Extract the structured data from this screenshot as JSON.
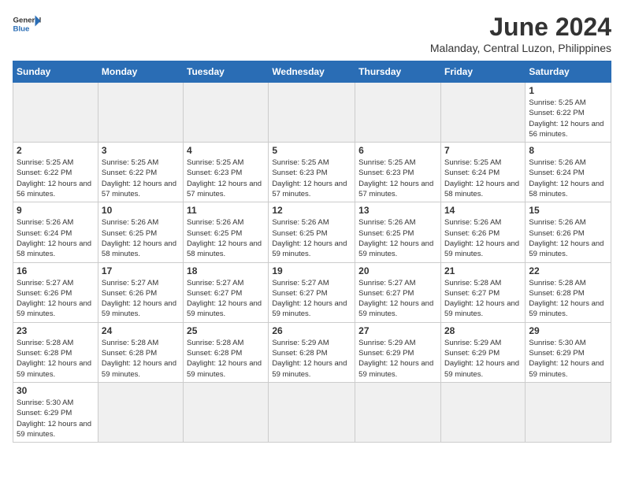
{
  "header": {
    "logo_general": "General",
    "logo_blue": "Blue",
    "month_title": "June 2024",
    "subtitle": "Malanday, Central Luzon, Philippines"
  },
  "days_of_week": [
    "Sunday",
    "Monday",
    "Tuesday",
    "Wednesday",
    "Thursday",
    "Friday",
    "Saturday"
  ],
  "weeks": [
    [
      {
        "day": "",
        "empty": true
      },
      {
        "day": "",
        "empty": true
      },
      {
        "day": "",
        "empty": true
      },
      {
        "day": "",
        "empty": true
      },
      {
        "day": "",
        "empty": true
      },
      {
        "day": "",
        "empty": true
      },
      {
        "day": "1",
        "sunrise": "5:25 AM",
        "sunset": "6:22 PM",
        "daylight": "12 hours and 56 minutes."
      }
    ],
    [
      {
        "day": "2",
        "sunrise": "5:25 AM",
        "sunset": "6:22 PM",
        "daylight": "12 hours and 56 minutes."
      },
      {
        "day": "3",
        "sunrise": "5:25 AM",
        "sunset": "6:22 PM",
        "daylight": "12 hours and 57 minutes."
      },
      {
        "day": "4",
        "sunrise": "5:25 AM",
        "sunset": "6:23 PM",
        "daylight": "12 hours and 57 minutes."
      },
      {
        "day": "5",
        "sunrise": "5:25 AM",
        "sunset": "6:23 PM",
        "daylight": "12 hours and 57 minutes."
      },
      {
        "day": "6",
        "sunrise": "5:25 AM",
        "sunset": "6:23 PM",
        "daylight": "12 hours and 57 minutes."
      },
      {
        "day": "7",
        "sunrise": "5:25 AM",
        "sunset": "6:24 PM",
        "daylight": "12 hours and 58 minutes."
      },
      {
        "day": "8",
        "sunrise": "5:26 AM",
        "sunset": "6:24 PM",
        "daylight": "12 hours and 58 minutes."
      }
    ],
    [
      {
        "day": "9",
        "sunrise": "5:26 AM",
        "sunset": "6:24 PM",
        "daylight": "12 hours and 58 minutes."
      },
      {
        "day": "10",
        "sunrise": "5:26 AM",
        "sunset": "6:25 PM",
        "daylight": "12 hours and 58 minutes."
      },
      {
        "day": "11",
        "sunrise": "5:26 AM",
        "sunset": "6:25 PM",
        "daylight": "12 hours and 58 minutes."
      },
      {
        "day": "12",
        "sunrise": "5:26 AM",
        "sunset": "6:25 PM",
        "daylight": "12 hours and 59 minutes."
      },
      {
        "day": "13",
        "sunrise": "5:26 AM",
        "sunset": "6:25 PM",
        "daylight": "12 hours and 59 minutes."
      },
      {
        "day": "14",
        "sunrise": "5:26 AM",
        "sunset": "6:26 PM",
        "daylight": "12 hours and 59 minutes."
      },
      {
        "day": "15",
        "sunrise": "5:26 AM",
        "sunset": "6:26 PM",
        "daylight": "12 hours and 59 minutes."
      }
    ],
    [
      {
        "day": "16",
        "sunrise": "5:27 AM",
        "sunset": "6:26 PM",
        "daylight": "12 hours and 59 minutes."
      },
      {
        "day": "17",
        "sunrise": "5:27 AM",
        "sunset": "6:26 PM",
        "daylight": "12 hours and 59 minutes."
      },
      {
        "day": "18",
        "sunrise": "5:27 AM",
        "sunset": "6:27 PM",
        "daylight": "12 hours and 59 minutes."
      },
      {
        "day": "19",
        "sunrise": "5:27 AM",
        "sunset": "6:27 PM",
        "daylight": "12 hours and 59 minutes."
      },
      {
        "day": "20",
        "sunrise": "5:27 AM",
        "sunset": "6:27 PM",
        "daylight": "12 hours and 59 minutes."
      },
      {
        "day": "21",
        "sunrise": "5:28 AM",
        "sunset": "6:27 PM",
        "daylight": "12 hours and 59 minutes."
      },
      {
        "day": "22",
        "sunrise": "5:28 AM",
        "sunset": "6:28 PM",
        "daylight": "12 hours and 59 minutes."
      }
    ],
    [
      {
        "day": "23",
        "sunrise": "5:28 AM",
        "sunset": "6:28 PM",
        "daylight": "12 hours and 59 minutes."
      },
      {
        "day": "24",
        "sunrise": "5:28 AM",
        "sunset": "6:28 PM",
        "daylight": "12 hours and 59 minutes."
      },
      {
        "day": "25",
        "sunrise": "5:28 AM",
        "sunset": "6:28 PM",
        "daylight": "12 hours and 59 minutes."
      },
      {
        "day": "26",
        "sunrise": "5:29 AM",
        "sunset": "6:28 PM",
        "daylight": "12 hours and 59 minutes."
      },
      {
        "day": "27",
        "sunrise": "5:29 AM",
        "sunset": "6:29 PM",
        "daylight": "12 hours and 59 minutes."
      },
      {
        "day": "28",
        "sunrise": "5:29 AM",
        "sunset": "6:29 PM",
        "daylight": "12 hours and 59 minutes."
      },
      {
        "day": "29",
        "sunrise": "5:30 AM",
        "sunset": "6:29 PM",
        "daylight": "12 hours and 59 minutes."
      }
    ],
    [
      {
        "day": "30",
        "sunrise": "5:30 AM",
        "sunset": "6:29 PM",
        "daylight": "12 hours and 59 minutes."
      },
      {
        "day": "",
        "empty": true
      },
      {
        "day": "",
        "empty": true
      },
      {
        "day": "",
        "empty": true
      },
      {
        "day": "",
        "empty": true
      },
      {
        "day": "",
        "empty": true
      },
      {
        "day": "",
        "empty": true
      }
    ]
  ]
}
